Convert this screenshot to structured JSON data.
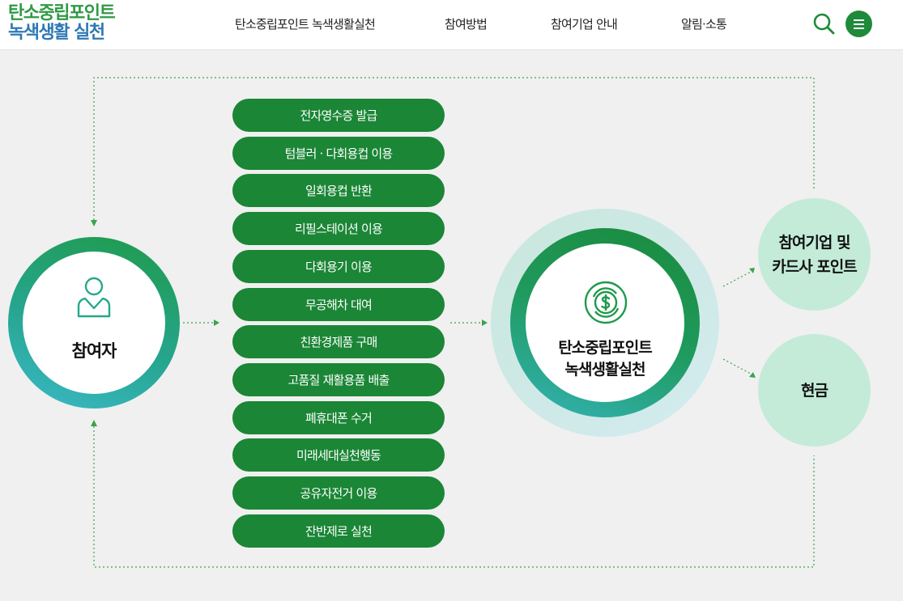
{
  "header": {
    "logo_line1": "탄소중립포인트",
    "logo_line2": "녹색생활 실천",
    "nav": [
      {
        "label": "탄소중립포인트 녹색생활실천"
      },
      {
        "label": "참여방법"
      },
      {
        "label": "참여기업 안내"
      },
      {
        "label": "알림·소통"
      }
    ],
    "search_icon": "search-icon",
    "menu_icon": "hamburger-menu-icon"
  },
  "diagram": {
    "participant": {
      "label": "참여자",
      "icon": "person-icon"
    },
    "activities": [
      {
        "label": "전자영수증 발급"
      },
      {
        "label": "텀블러 · 다회용컵 이용"
      },
      {
        "label": "일회용컵 반환"
      },
      {
        "label": "리필스테이션 이용"
      },
      {
        "label": "다회용기 이용"
      },
      {
        "label": "무공해차 대여"
      },
      {
        "label": "친환경제품 구매"
      },
      {
        "label": "고품질 재활용품 배출"
      },
      {
        "label": "폐휴대폰 수거"
      },
      {
        "label": "미래세대실천행동"
      },
      {
        "label": "공유자전거 이용"
      },
      {
        "label": "잔반제로 실천"
      }
    ],
    "center": {
      "line1": "탄소중립포인트",
      "line2": "녹색생활실천",
      "icon": "dollar-coin-icon"
    },
    "rewards": {
      "points_line1": "참여기업 및",
      "points_line2": "카드사 포인트",
      "cash": "현금"
    }
  },
  "colors": {
    "logo_green": "#2f9a45",
    "logo_blue": "#2e78b4",
    "button_green": "#1b8636",
    "reward_mint": "#c3ebd8",
    "dotted_line": "#3aa34c"
  }
}
